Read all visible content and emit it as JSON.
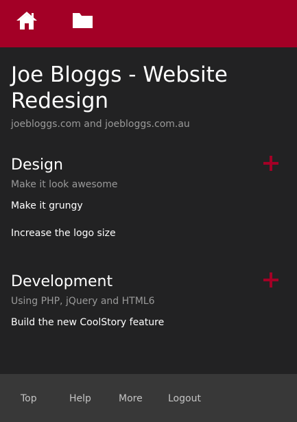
{
  "header": {
    "icons": [
      {
        "name": "home-icon",
        "label": "Home"
      },
      {
        "name": "folder-icon",
        "label": "Projects"
      }
    ],
    "background_color": "#a30026"
  },
  "project": {
    "title": "Joe Bloggs - Website Redesign",
    "subtitle": "joebloggs.com and joebloggs.com.au"
  },
  "sections": [
    {
      "title": "Design",
      "subtitle": "Make it look awesome",
      "tasks": [
        "Make it grungy",
        "Increase the logo size"
      ],
      "add_icon": "plus-icon"
    },
    {
      "title": "Development",
      "subtitle": "Using PHP, jQuery and HTML6",
      "tasks": [
        "Build the new CoolStory feature"
      ],
      "add_icon": "plus-icon"
    }
  ],
  "footer": {
    "links": [
      "Top",
      "Help",
      "More",
      "Logout"
    ]
  },
  "colors": {
    "accent": "#a30026",
    "background": "#222223",
    "footer": "#383838",
    "muted_text": "#9a9a9a"
  }
}
